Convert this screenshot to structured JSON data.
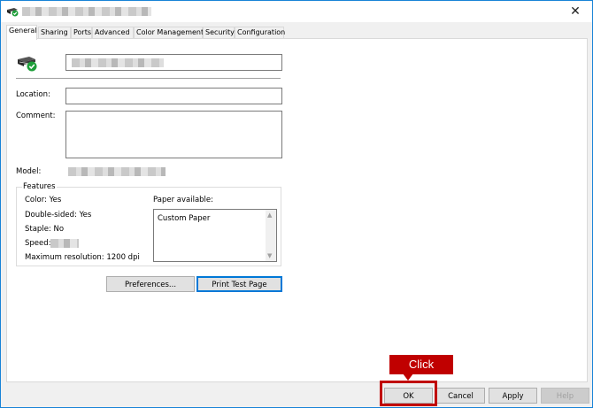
{
  "window": {
    "close_glyph": "✕"
  },
  "tabs": [
    {
      "label": "General",
      "active": true
    },
    {
      "label": "Sharing",
      "active": false
    },
    {
      "label": "Ports",
      "active": false
    },
    {
      "label": "Advanced",
      "active": false
    },
    {
      "label": "Color Management",
      "active": false
    },
    {
      "label": "Security",
      "active": false
    },
    {
      "label": "Configuration",
      "active": false
    }
  ],
  "general": {
    "location_label": "Location:",
    "location_value": "",
    "comment_label": "Comment:",
    "comment_value": "",
    "model_label": "Model:"
  },
  "features": {
    "title": "Features",
    "color": "Color: Yes",
    "double_sided": "Double-sided: Yes",
    "staple": "Staple: No",
    "speed": "Speed:",
    "max_resolution": "Maximum resolution: 1200 dpi",
    "paper_available_label": "Paper available:",
    "paper_items": [
      "Custom Paper"
    ]
  },
  "buttons": {
    "preferences": "Preferences...",
    "print_test_page": "Print Test Page",
    "ok": "OK",
    "cancel": "Cancel",
    "apply": "Apply",
    "help": "Help"
  },
  "annotation": {
    "callout_text": "Click"
  },
  "colors": {
    "accent": "#0078d7",
    "callout_red": "#c00000",
    "status_green": "#1e9e3a"
  }
}
